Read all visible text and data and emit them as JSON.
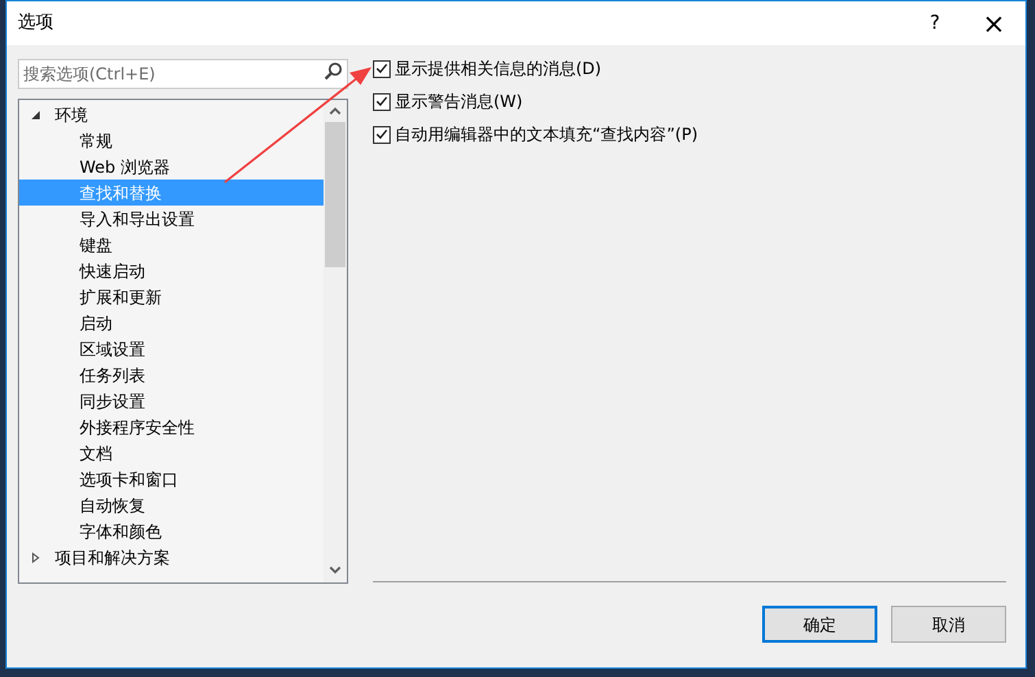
{
  "window": {
    "title": "选项",
    "help": "?",
    "close": "×"
  },
  "search": {
    "placeholder": "搜索选项(Ctrl+E)"
  },
  "tree": [
    {
      "label": "环境",
      "expanded": true,
      "selected": false,
      "children": [
        {
          "label": "常规",
          "selected": false
        },
        {
          "label": "Web 浏览器",
          "selected": false
        },
        {
          "label": "查找和替换",
          "selected": true
        },
        {
          "label": "导入和导出设置",
          "selected": false
        },
        {
          "label": "键盘",
          "selected": false
        },
        {
          "label": "快速启动",
          "selected": false
        },
        {
          "label": "扩展和更新",
          "selected": false
        },
        {
          "label": "启动",
          "selected": false
        },
        {
          "label": "区域设置",
          "selected": false
        },
        {
          "label": "任务列表",
          "selected": false
        },
        {
          "label": "同步设置",
          "selected": false
        },
        {
          "label": "外接程序安全性",
          "selected": false
        },
        {
          "label": "文档",
          "selected": false
        },
        {
          "label": "选项卡和窗口",
          "selected": false
        },
        {
          "label": "自动恢复",
          "selected": false
        },
        {
          "label": "字体和颜色",
          "selected": false
        }
      ]
    },
    {
      "label": "项目和解决方案",
      "expanded": false,
      "selected": false
    }
  ],
  "options": [
    {
      "label": "显示提供相关信息的消息(D)",
      "checked": true
    },
    {
      "label": "显示警告消息(W)",
      "checked": true
    },
    {
      "label": "自动用编辑器中的文本填充“查找内容”(P)",
      "checked": true
    }
  ],
  "buttons": [
    {
      "label": "确定",
      "default": true
    },
    {
      "label": "取消",
      "default": false
    }
  ]
}
